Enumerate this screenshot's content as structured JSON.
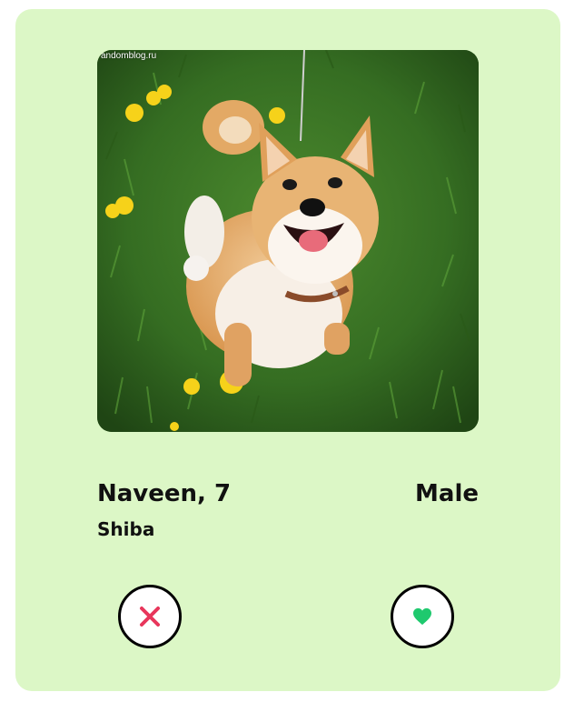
{
  "profile": {
    "name_age": "Naveen, 7",
    "breed": "Shiba",
    "gender": "Male",
    "photo_watermark": "andomblog.ru"
  },
  "actions": {
    "reject_icon": "close-icon",
    "like_icon": "heart-icon"
  },
  "colors": {
    "card_background": "#dcf7c6",
    "reject_icon": "#e8365b",
    "like_icon": "#1fc96e",
    "button_border": "#000000"
  }
}
